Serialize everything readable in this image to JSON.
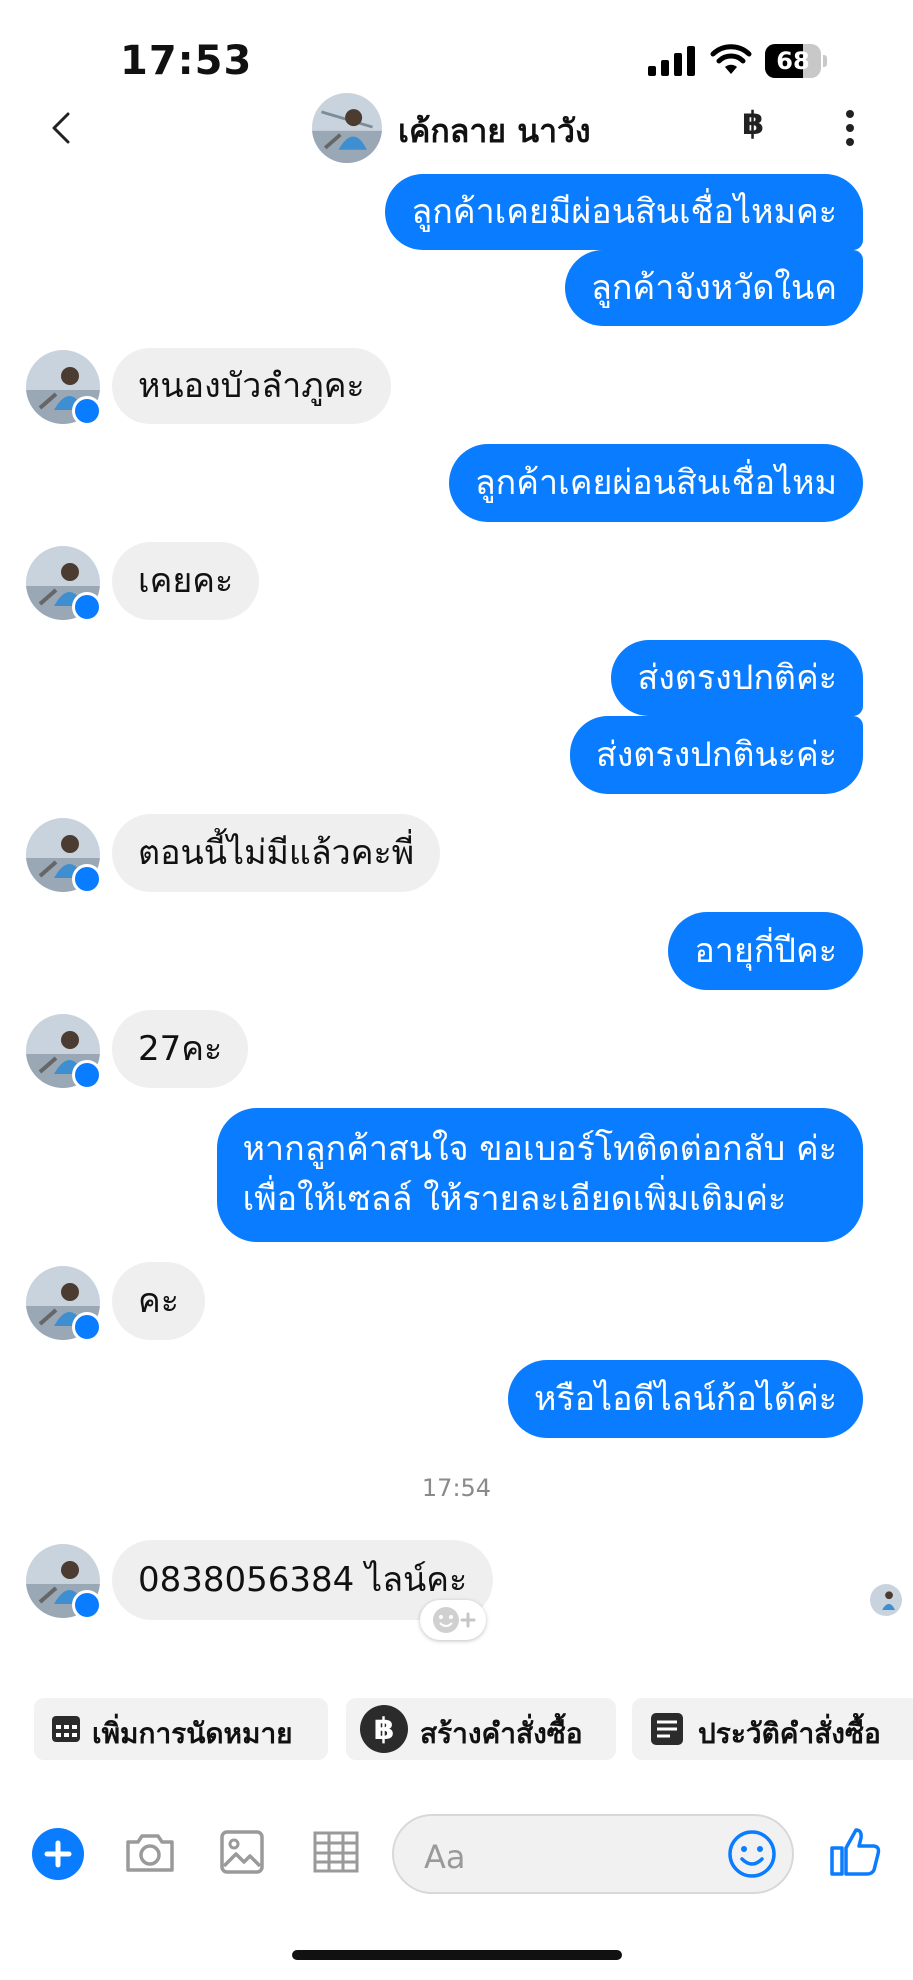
{
  "status_bar": {
    "time": "17:53",
    "battery": "68",
    "battery_level": 0.68
  },
  "header": {
    "contact_name": "เค้กลาย นาวัง"
  },
  "messages": [
    {
      "dir": "out",
      "text": "ลูกค้าเคยมีผ่อนสินเชื่อไหมคะ"
    },
    {
      "dir": "out",
      "text": "ลูกค้าจังหวัดในค"
    },
    {
      "dir": "in",
      "text": "หนองบัวลำภูคะ"
    },
    {
      "dir": "out",
      "text": "ลูกค้าเคยผ่อนสินเชื่อไหม"
    },
    {
      "dir": "in",
      "text": "เคยคะ"
    },
    {
      "dir": "out",
      "text": "ส่งตรงปกติค่ะ"
    },
    {
      "dir": "out",
      "text": "ส่งตรงปกตินะค่ะ"
    },
    {
      "dir": "in",
      "text": "ตอนนี้ไม่มีแล้วคะพี่"
    },
    {
      "dir": "out",
      "text": "อายุกี่ปีคะ"
    },
    {
      "dir": "in",
      "text": "27คะ"
    },
    {
      "dir": "out",
      "text": "หากลูกค้าสนใจ ขอเบอร์โทติดต่อกลับ ค่ะ",
      "text2": "เพื่อให้เซลล์ ให้รายละเอียดเพิ่มเติมค่ะ"
    },
    {
      "dir": "in",
      "text": "คะ"
    },
    {
      "dir": "out",
      "text": "หรือไอดีไลน์ก้อได้ค่ะ"
    },
    {
      "dir": "in",
      "text": "0838056384 ไลน์คะ"
    }
  ],
  "timestamp": "17:54",
  "quick_actions": [
    {
      "label": "เพิ่มการนัดหมาย",
      "icon": "calendar-icon"
    },
    {
      "label": "สร้างคำสั่งซื้อ",
      "icon": "baht-icon"
    },
    {
      "label": "ประวัติคำสั่งซื้อ",
      "icon": "order-list-icon"
    }
  ],
  "composer": {
    "placeholder": "Aa"
  },
  "colors": {
    "accent": "#0a7cff",
    "incoming_bubble": "#efefef"
  }
}
